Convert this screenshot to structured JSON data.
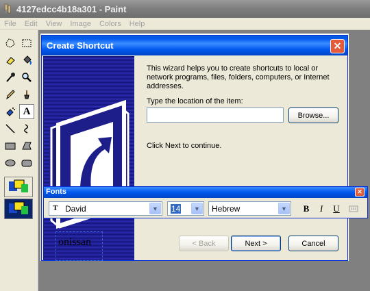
{
  "window": {
    "title": "4127edcc4b18a301 - Paint",
    "icon": "paint-app-icon"
  },
  "menubar": {
    "items": [
      "File",
      "Edit",
      "View",
      "Image",
      "Colors",
      "Help"
    ]
  },
  "toolbox": {
    "tools": [
      "free-form-select-icon",
      "rect-select-icon",
      "eraser-icon",
      "fill-icon",
      "color-picker-icon",
      "magnifier-icon",
      "pencil-icon",
      "brush-icon",
      "airbrush-icon",
      "text-icon",
      "line-icon",
      "curve-icon",
      "rectangle-icon",
      "polygon-icon",
      "ellipse-icon",
      "rounded-rect-icon"
    ],
    "selected_tool": "text-icon"
  },
  "dialog": {
    "title": "Create Shortcut",
    "description": "This wizard helps you to create shortcuts to local or network programs, files, folders, computers, or Internet addresses.",
    "location_label": "Type the location of the item:",
    "location_value": "",
    "browse_label": "Browse...",
    "continue_text": "Click Next to continue.",
    "back_label": "< Back",
    "next_label": "Next >",
    "cancel_label": "Cancel"
  },
  "fonts_toolbar": {
    "title": "Fonts",
    "font_name": "David",
    "font_size": "14",
    "script": "Hebrew",
    "bold_label": "B",
    "italic_label": "I",
    "underline_label": "U"
  },
  "canvas_text": {
    "text": "onissan"
  },
  "colors": {
    "dialog_title": "#0058ee",
    "close_button": "#e35b3b",
    "wizard_panel": "#16167a"
  }
}
